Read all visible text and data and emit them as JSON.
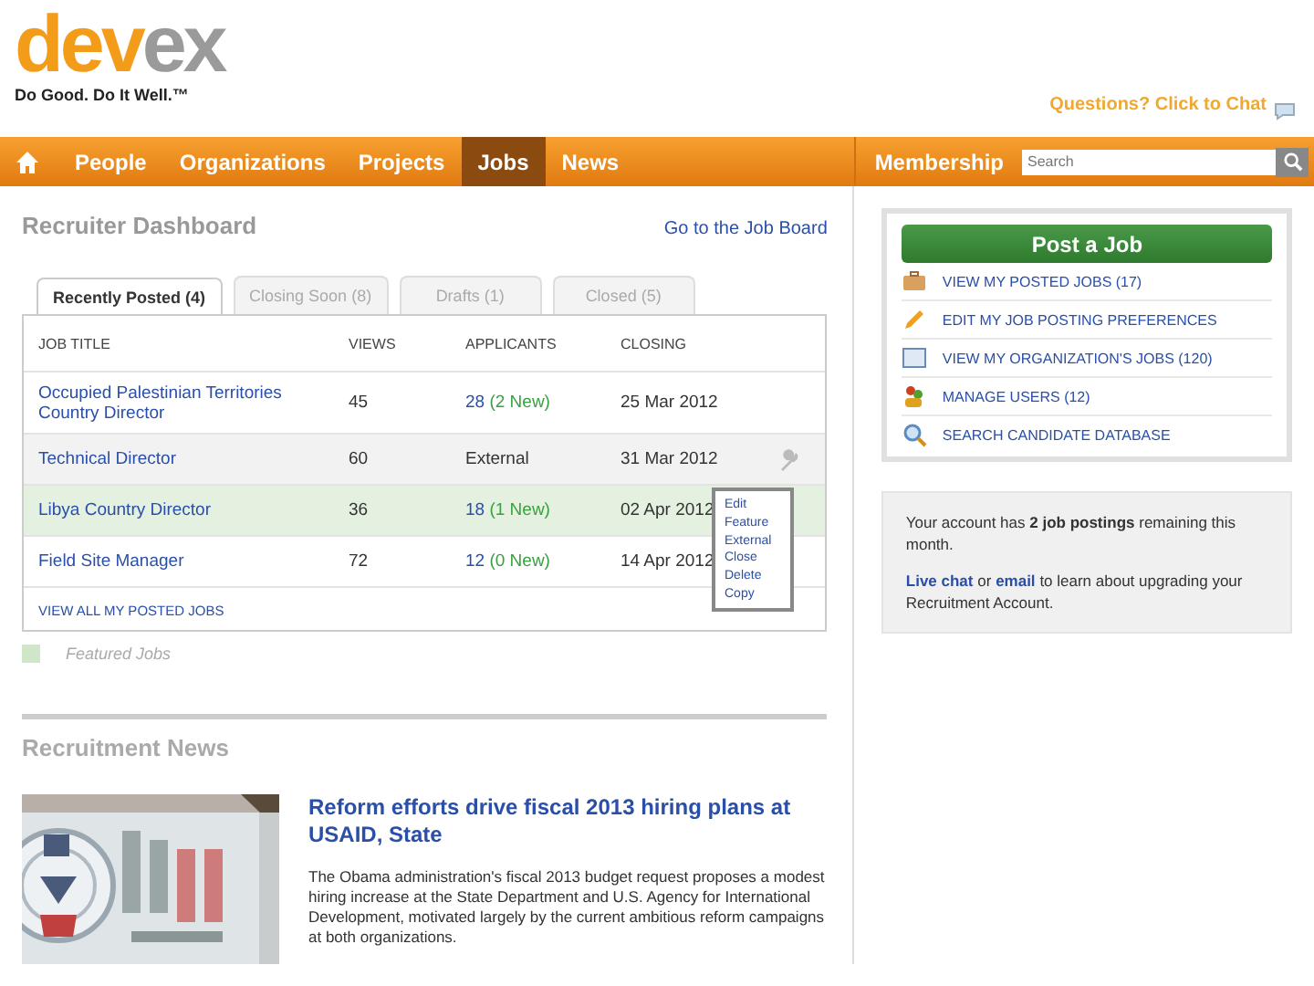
{
  "header": {
    "logo_primary": "dev",
    "logo_secondary": "ex",
    "tagline": "Do Good. Do It Well.™",
    "chat_link": "Questions? Click to Chat"
  },
  "nav": {
    "items": [
      {
        "label": "People",
        "selected": false
      },
      {
        "label": "Organizations",
        "selected": false
      },
      {
        "label": "Projects",
        "selected": false
      },
      {
        "label": "Jobs",
        "selected": true
      },
      {
        "label": "News",
        "selected": false
      }
    ],
    "membership": "Membership",
    "search": {
      "placeholder": "Search"
    }
  },
  "dashboard": {
    "title": "Recruiter Dashboard",
    "board_link": "Go to the Job Board",
    "tabs": [
      {
        "label": "Recently Posted (4)",
        "selected": true
      },
      {
        "label": "Closing Soon (8)",
        "selected": false
      },
      {
        "label": "Drafts (1)",
        "selected": false
      },
      {
        "label": "Closed (5)",
        "selected": false
      }
    ],
    "table": {
      "columns": [
        "JOB TITLE",
        "VIEWS",
        "APPLICANTS",
        "CLOSING"
      ],
      "rows": [
        {
          "title": "Occupied Palestinian Territories Country Director",
          "views": "45",
          "applicants": "28",
          "new": "(2 New)",
          "closing": "25 Mar 2012",
          "featured": false,
          "hovered": false
        },
        {
          "title": "Technical Director",
          "views": "60",
          "applicants": "External",
          "closing": "31 Mar 2012",
          "featured": false,
          "hovered": true
        },
        {
          "title": "Libya Country Director",
          "views": "36",
          "applicants": "18",
          "new": "(1 New)",
          "closing": "02 Apr 2012",
          "featured": true,
          "hovered": false
        },
        {
          "title": "Field Site Manager",
          "views": "72",
          "applicants": "12",
          "new": "(0 New)",
          "closing": "14 Apr 2012",
          "featured": false,
          "hovered": false
        }
      ],
      "view_all": "VIEW ALL MY POSTED JOBS"
    },
    "row_menu": [
      "Edit",
      "Feature",
      "External",
      "Close",
      "Delete",
      "Copy"
    ],
    "legend": "Featured Jobs"
  },
  "news": {
    "title": "Recruitment News",
    "article": {
      "headline": "Reform efforts drive fiscal 2013 hiring plans at USAID, State",
      "summary": "The Obama administration's fiscal 2013 budget request proposes a modest hiring increase at the State Department and U.S. Agency for International Development, motivated largely by the current ambitious reform campaigns at both organizations."
    }
  },
  "sidebar": {
    "post_button": "Post a Job",
    "links": [
      {
        "kind": "briefcase",
        "label": "VIEW MY POSTED JOBS (17)"
      },
      {
        "kind": "pencil",
        "label": "EDIT MY JOB POSTING PREFERENCES"
      },
      {
        "kind": "window",
        "label": "VIEW MY ORGANIZATION'S JOBS (120)"
      },
      {
        "kind": "users",
        "label": "MANAGE USERS (12)"
      },
      {
        "kind": "search",
        "label": "SEARCH CANDIDATE DATABASE"
      }
    ],
    "account_note": "Your account has **2 job postings** remaining this month.",
    "upgrade": {
      "chat_link": "Live chat",
      "or": "or",
      "email_link": "email",
      "rest": "to learn about upgrading your Recruitment Account."
    }
  }
}
